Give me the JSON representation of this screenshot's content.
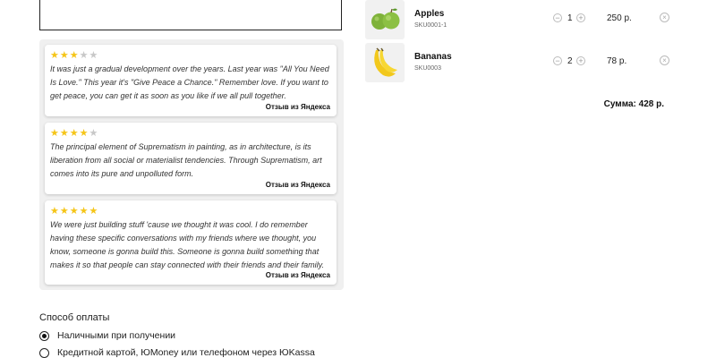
{
  "reviews": [
    {
      "stars_filled": 3,
      "stars_total": 5,
      "text": "It was just a gradual development over the years. Last year was \"All You Need Is Love.\" This year it's \"Give Peace a Chance.\" Remember love. If you want to get peace, you can get it as soon as you like if we all pull together.",
      "source": "Отзыв из Яндекса"
    },
    {
      "stars_filled": 4,
      "stars_total": 5,
      "text": "The principal element of Suprematism in painting, as in architecture, is its liberation from all social or materialist tendencies. Through Suprematism, art comes into its pure and unpolluted form.",
      "source": "Отзыв из Яндекса"
    },
    {
      "stars_filled": 5,
      "stars_total": 5,
      "text": "We were just building stuff 'cause we thought it was cool. I do remember having these specific conversations with my friends where we thought, you know, someone is gonna build this. Someone is gonna build something that makes it so that people can stay connected with their friends and their family.",
      "source": "Отзыв из Яндекса"
    }
  ],
  "payment": {
    "title": "Способ оплаты",
    "options": [
      {
        "label": "Наличными при получении",
        "selected": true
      },
      {
        "label": "Кредитной картой, ЮMoney или телефоном через ЮKassa",
        "selected": false
      }
    ]
  },
  "cart": {
    "items": [
      {
        "name": "Apples",
        "sku": "SKU0001-1",
        "qty": "1",
        "price": "250 р.",
        "image_icon": "apples-image"
      },
      {
        "name": "Bananas",
        "sku": "SKU0003",
        "qty": "2",
        "price": "78 р.",
        "image_icon": "bananas-image"
      }
    ],
    "total": "Сумма: 428 р."
  },
  "colors": {
    "star_on": "#f5c518",
    "star_off": "#c8c8c8"
  }
}
